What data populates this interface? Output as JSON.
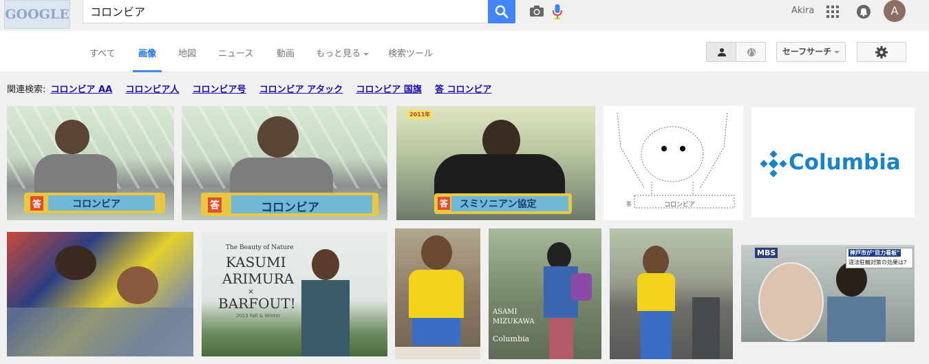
{
  "logo": {
    "text": "GOOGLE"
  },
  "search": {
    "query": "コロンビア"
  },
  "account": {
    "name": "Akira",
    "avatar_initial": "A"
  },
  "tabs": [
    {
      "label": "すべて"
    },
    {
      "label": "画像",
      "active": true
    },
    {
      "label": "地図"
    },
    {
      "label": "ニュース"
    },
    {
      "label": "動画"
    },
    {
      "label": "もっと見る"
    },
    {
      "label": "検索ツール"
    }
  ],
  "toolbar": {
    "safesearch_label": "セーフサーチ"
  },
  "related": {
    "label": "関連検索:",
    "links": [
      "コロンビア AA",
      "コロンビア人",
      "コロンビア号",
      "コロンビア アタック",
      "コロンビア 国旗",
      "答 コロンビア"
    ]
  },
  "images": {
    "row1": [
      {
        "caption": "コロンビア",
        "badge": "答"
      },
      {
        "caption": "コロンビア",
        "badge": "答"
      },
      {
        "caption": "スミソニアン協定",
        "badge": "答",
        "top_text": "2011年"
      },
      {
        "caption": "コロンビア",
        "badge": "答"
      },
      {
        "caption": "Columbia"
      }
    ],
    "row2": [
      {},
      {
        "line1": "The Beauty of Nature",
        "line2": "KASUMI",
        "line3": "ARIMURA",
        "line4": "×",
        "line5": "BARFOUT!",
        "line6": "2015 Fall & Winter"
      },
      {},
      {
        "line1": "ASAMI",
        "line2": "MIZUKAWA",
        "line3": "Columbia"
      },
      {},
      {
        "corner": "MBS",
        "headline": "神戸市が\"目力看板\"",
        "subline": "違法駐輪対策の効果は?"
      }
    ]
  },
  "colors": {
    "accent": "#4285f4",
    "link": "#1a0dab",
    "columbia_blue": "#1b82c4"
  }
}
